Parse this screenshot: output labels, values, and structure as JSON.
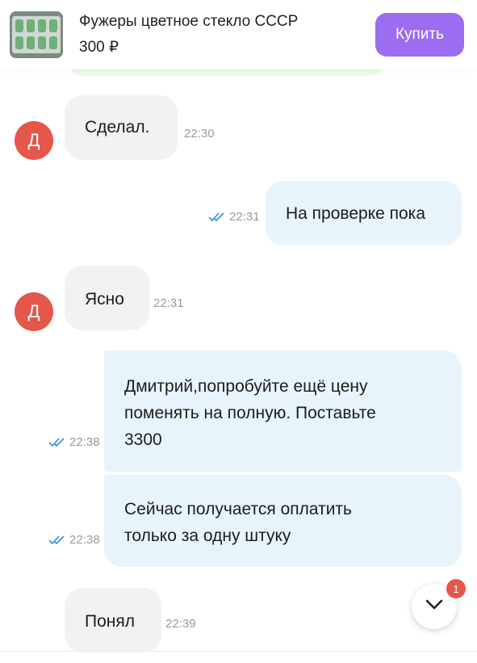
{
  "header": {
    "title": "Фужеры цветное стекло СССР",
    "price": "300 ₽",
    "buy_label": "Купить"
  },
  "colors": {
    "accent": "#9b6df1",
    "avatar": "#e4574a",
    "incoming_bubble": "#f2f2f2",
    "outgoing_bubble": "#e8f4fc",
    "read_check": "#2a8fd8"
  },
  "messages": [
    {
      "direction": "in",
      "avatar_letter": "Д",
      "text": "Сделал.",
      "time": "22:30"
    },
    {
      "direction": "out",
      "text": "На проверке пока",
      "time": "22:31",
      "read": true
    },
    {
      "direction": "in",
      "avatar_letter": "Д",
      "text": "Ясно",
      "time": "22:31"
    },
    {
      "direction": "out",
      "text": "Дмитрий,попробуйте  ещё цену\nпоменять на полную. Поставьте\n3300",
      "time": "22:38",
      "read": true
    },
    {
      "direction": "out",
      "text": "Сейчас получается оплатить\nтолько за одну штуку",
      "time": "22:38",
      "read": true
    },
    {
      "direction": "in",
      "text": "Понял",
      "time": "22:39"
    }
  ],
  "scroll_button": {
    "icon": "chevron-down-icon",
    "unread_count": "1"
  }
}
